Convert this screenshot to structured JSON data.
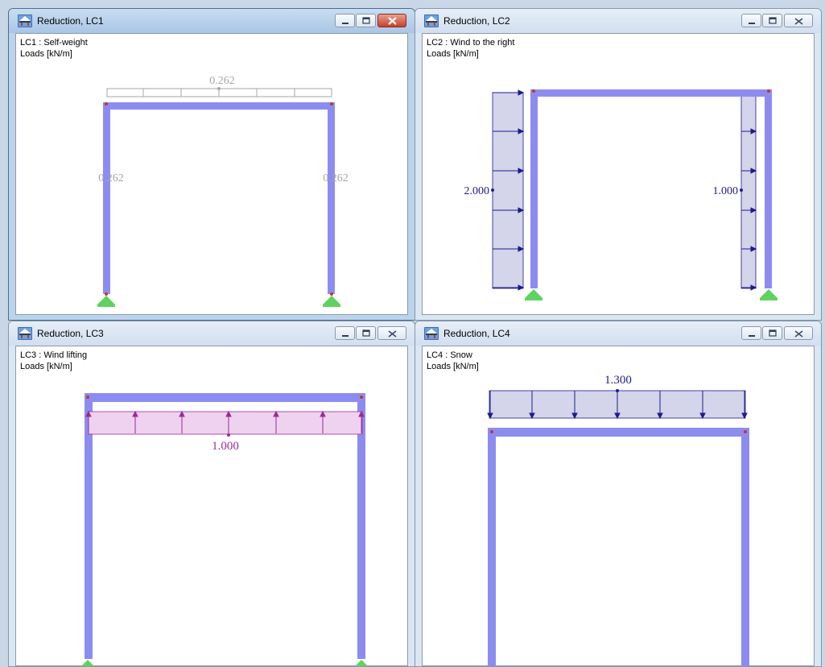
{
  "windows": [
    {
      "title": "Reduction, LC1",
      "lc_label": "LC1 : Self-weight",
      "units_label": "Loads [kN/m]",
      "beam_load": "0.262",
      "left_load": "0.262",
      "right_load": "0.262"
    },
    {
      "title": "Reduction, LC2",
      "lc_label": "LC2 : Wind to the right",
      "units_label": "Loads [kN/m]",
      "left_load": "2.000",
      "right_load": "1.000"
    },
    {
      "title": "Reduction, LC3",
      "lc_label": "LC3 : Wind lifting",
      "units_label": "Loads [kN/m]",
      "beam_load": "1.000"
    },
    {
      "title": "Reduction, LC4",
      "lc_label": "LC4 : Snow",
      "units_label": "Loads [kN/m]",
      "beam_load": "1.300"
    }
  ],
  "colors": {
    "member": "#8c8cf0",
    "support": "#5fd35f",
    "self_weight_load": "#a6a6a6",
    "wind_load": "#1c1c8c",
    "lifting_load": "#9a2a9a",
    "load_fill": "#d4d4ea",
    "lifting_fill": "#efd2ef"
  },
  "icons": {
    "app": "rstab-frame-icon",
    "minimize": "minimize-icon",
    "maximize": "maximize-icon",
    "close": "close-icon"
  }
}
